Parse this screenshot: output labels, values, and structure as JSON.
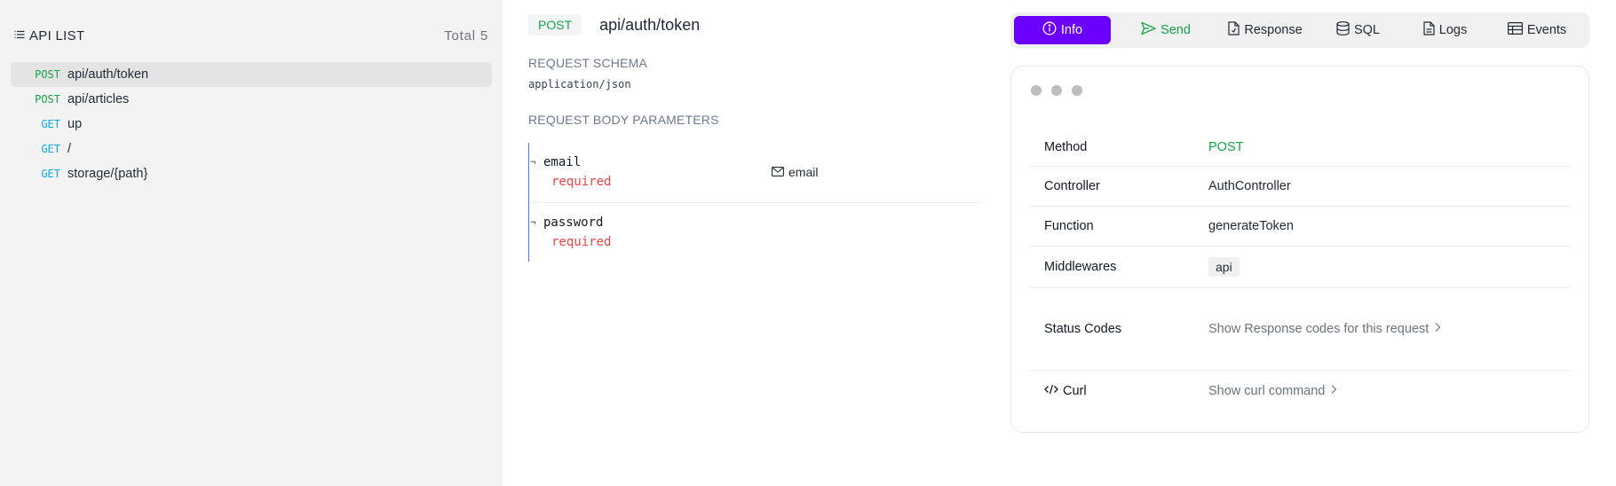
{
  "sidebar": {
    "title": "API LIST",
    "total": "Total 5",
    "items": [
      {
        "method": "POST",
        "path": "api/auth/token",
        "active": true
      },
      {
        "method": "POST",
        "path": "api/articles",
        "active": false
      },
      {
        "method": "GET",
        "path": "up",
        "active": false
      },
      {
        "method": "GET",
        "path": "/",
        "active": false
      },
      {
        "method": "GET",
        "path": "storage/{path}",
        "active": false
      }
    ]
  },
  "endpoint": {
    "method": "POST",
    "path": "api/auth/token"
  },
  "request": {
    "schema_label": "REQUEST SCHEMA",
    "schema_value": "application/json",
    "params_label": "REQUEST BODY PARAMETERS",
    "params": [
      {
        "tick": "¬",
        "name": "email",
        "required": "required",
        "type": "email",
        "type_icon": "envelope-icon"
      },
      {
        "tick": "¬",
        "name": "password",
        "required": "required",
        "type": "",
        "type_icon": ""
      }
    ]
  },
  "tabs": [
    {
      "label": "Info",
      "icon": "info-icon",
      "active": true
    },
    {
      "label": "Send",
      "icon": "send-icon",
      "active": false
    },
    {
      "label": "Response",
      "icon": "file-icon",
      "active": false
    },
    {
      "label": "SQL",
      "icon": "database-icon",
      "active": false
    },
    {
      "label": "Logs",
      "icon": "document-icon",
      "active": false
    },
    {
      "label": "Events",
      "icon": "table-icon",
      "active": false
    }
  ],
  "info": {
    "method_label": "Method",
    "method_value": "POST",
    "controller_label": "Controller",
    "controller_value": "AuthController",
    "function_label": "Function",
    "function_value": "generateToken",
    "middlewares_label": "Middlewares",
    "middlewares_value": "api",
    "status_label": "Status Codes",
    "status_value": "Show Response codes for this request",
    "curl_label": "Curl",
    "curl_value": "Show curl command"
  },
  "colors": {
    "accent": "#6c00ff",
    "post": "#16a34a",
    "get": "#0ea5e9",
    "required": "#ef4444",
    "param_border": "#3b82f6"
  }
}
